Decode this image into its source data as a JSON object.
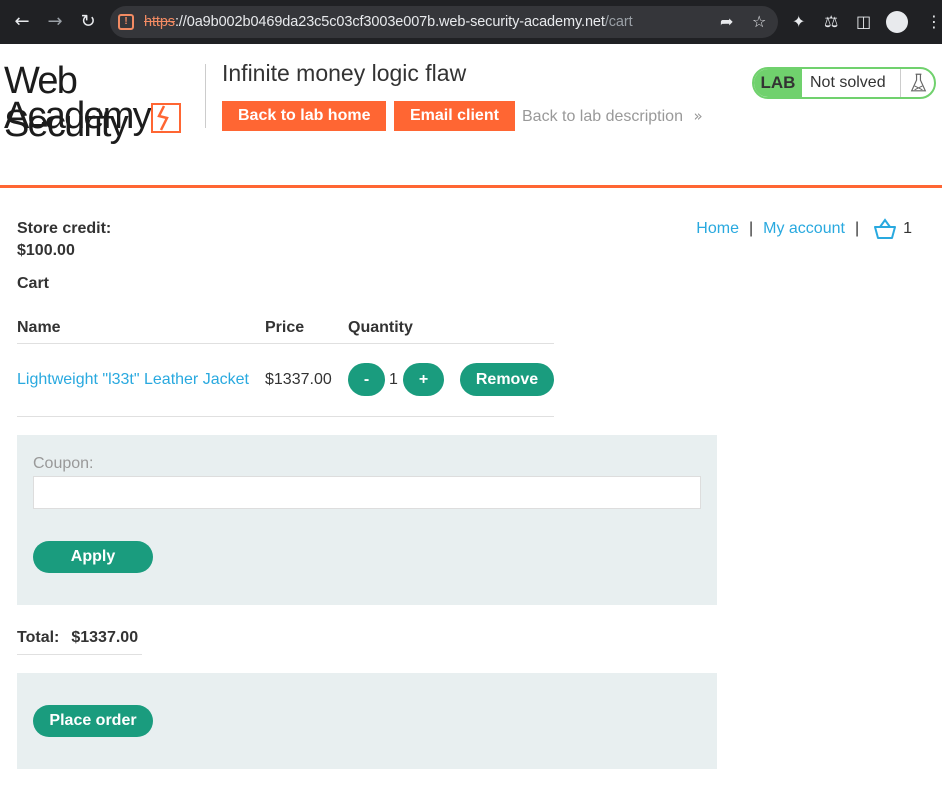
{
  "browser": {
    "url_scheme": "https",
    "url_sep": "://",
    "url_host": "0a9b002b0469da23c5c03cf3003e007b.web-security-academy.net",
    "url_path": "/cart"
  },
  "header": {
    "logo_line1": "Web Security",
    "logo_line2": "Academy",
    "lab_title": "Infinite money logic flaw",
    "back_to_lab_home": "Back to lab home",
    "email_client": "Email client",
    "back_to_description": "Back to lab description",
    "lab_tag": "LAB",
    "lab_status": "Not solved",
    "accent_color": "#ff6633",
    "status_color": "#70d16d"
  },
  "nav": {
    "home": "Home",
    "separator": "|",
    "my_account": "My account",
    "cart_count": "1"
  },
  "store": {
    "credit_label": "Store credit:",
    "credit_value": "$100.00"
  },
  "cart": {
    "heading": "Cart",
    "columns": [
      "Name",
      "Price",
      "Quantity"
    ],
    "items": [
      {
        "name": "Lightweight \"l33t\" Leather Jacket",
        "price": "$1337.00",
        "quantity": "1",
        "decrease_label": "-",
        "increase_label": "+",
        "remove_label": "Remove"
      }
    ]
  },
  "coupon": {
    "label": "Coupon:",
    "value": "",
    "apply_label": "Apply"
  },
  "total": {
    "label": "Total:",
    "value": "$1337.00"
  },
  "order": {
    "place_order_label": "Place order"
  },
  "colors": {
    "link": "#29a9df",
    "button_green": "#1a9c7e",
    "panel_bg": "#e8eff0"
  }
}
